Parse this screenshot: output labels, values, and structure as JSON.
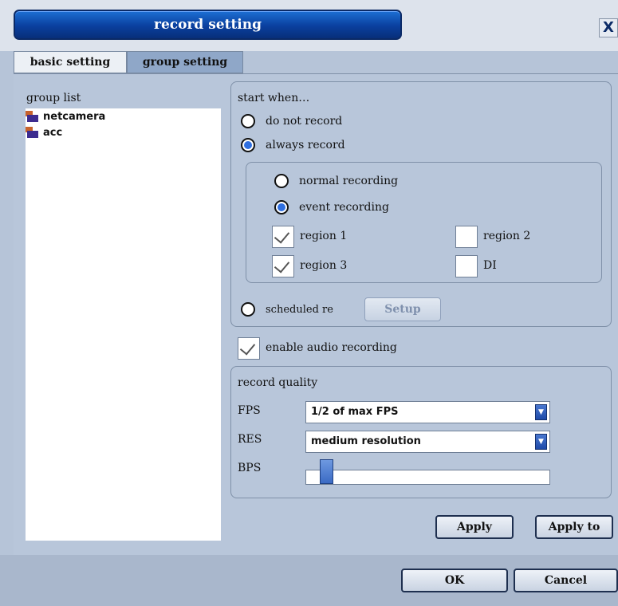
{
  "window": {
    "title": "record setting",
    "close_label": "X"
  },
  "tabs": {
    "basic": "basic setting",
    "group": "group setting"
  },
  "group_list": {
    "label": "group list",
    "items": [
      {
        "name": "netcamera",
        "icon": "camera-group-icon"
      },
      {
        "name": "acc",
        "icon": "sensor-group-icon"
      }
    ]
  },
  "start_when": {
    "label": "start when…",
    "options": {
      "do_not_record": "do not record",
      "always_record": "always record",
      "scheduled": "scheduled re"
    },
    "selected": "always_record",
    "always": {
      "normal": "normal recording",
      "event": "event recording",
      "selected": "event",
      "regions": [
        {
          "label": "region 1",
          "checked": true
        },
        {
          "label": "region 2",
          "checked": false
        },
        {
          "label": "region 3",
          "checked": true
        },
        {
          "label": "DI",
          "checked": false
        }
      ]
    },
    "setup_label": "Setup"
  },
  "audio": {
    "label": "enable audio recording",
    "checked": true
  },
  "quality": {
    "label": "record quality",
    "fps_label": "FPS",
    "fps_value": "1/2 of max FPS",
    "res_label": "RES",
    "res_value": "medium resolution",
    "bps_label": "BPS",
    "bps_level": 0.06
  },
  "buttons": {
    "apply": "Apply",
    "apply_to": "Apply to",
    "ok": "OK",
    "cancel": "Cancel"
  },
  "colors": {
    "title_gradient": "#0a3f9e",
    "radio_selected": "#2f6fe0",
    "panel": "#b8c6da"
  }
}
